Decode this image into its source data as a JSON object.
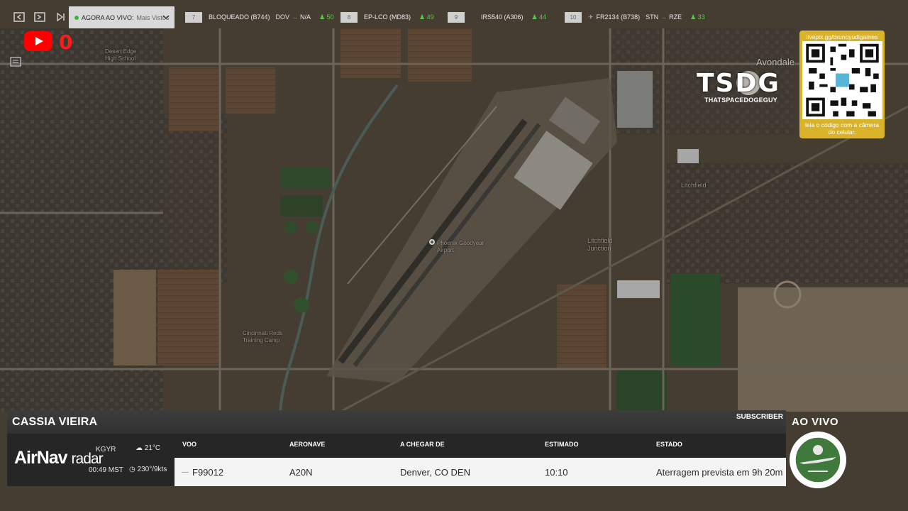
{
  "topbar": {
    "live_label": "AGORA AO VIVO:",
    "live_sort": "Mais Vistos",
    "flights": [
      {
        "rank": "7",
        "flight": "BLOQUEADO (B744)",
        "origin": "DOV",
        "destination": "N/A",
        "views": "50"
      },
      {
        "rank": "8",
        "flight": "EP-LCO (MD83)",
        "origin": "",
        "destination": "",
        "views": "49"
      },
      {
        "rank": "9",
        "flight": "IRS540 (A306)",
        "origin": "",
        "destination": "",
        "views": "44"
      },
      {
        "rank": "10",
        "flight": "FR2134 (B738)",
        "origin": "STN",
        "destination": "RZE",
        "views": "33"
      }
    ]
  },
  "youtube": {
    "count": "0"
  },
  "logo": {
    "text": "TSDG",
    "subtitle": "THATSPACEDOGEGUY"
  },
  "qr": {
    "url": "livepix.gg/brunoyudigames",
    "caption": "leia o código com a câmera do celular."
  },
  "map_labels": {
    "avondale": "Avondale",
    "litchfield": "Litchfield",
    "litchfield_junction": "Litchfield Junction",
    "airport": "Phoenix Goodyear Airport",
    "training_camp": "Cincinnati Reds Training Camp",
    "desert_edge": "Desert Edge High School"
  },
  "panel": {
    "streamer_name": "CASSIA VIEIRA",
    "subscriber_label": "SUBSCRIBER",
    "brand_bold": "AirNav",
    "brand_light": "radar",
    "airport_code": "KGYR",
    "local_time": "00:49 MST",
    "temperature": "21°C",
    "wind": "230°/9kts",
    "headers": {
      "flight": "VOO",
      "aircraft": "AERONAVE",
      "arriving_from": "A CHEGAR DE",
      "estimated": "ESTIMADO",
      "status": "ESTADO"
    },
    "row": {
      "flight": "F99012",
      "aircraft": "A20N",
      "arriving_from": "Denver, CO DEN",
      "estimated": "10:10",
      "status": "Aterragem prevista em 9h 20m"
    }
  },
  "live_badge": "AO VIVO",
  "colors": {
    "accent_green": "#3bb53b",
    "qr_gold": "#d9b32a",
    "youtube_red": "#ff0000"
  }
}
